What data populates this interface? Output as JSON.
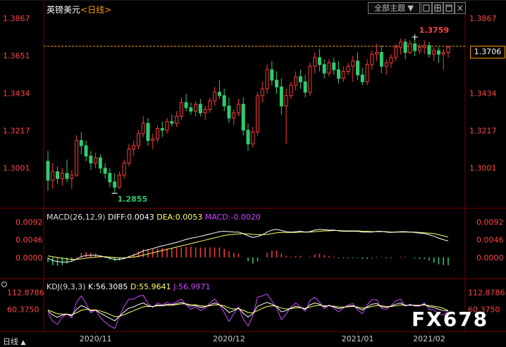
{
  "header": {
    "symbol": "英镑美元",
    "period": "<日线>",
    "theme_button": "全部主题",
    "theme_arrow": "▼"
  },
  "current_price": "1.3706",
  "watermark": "FX678",
  "period_tab": "日线",
  "period_tab_arrow": "▲",
  "macd_label": {
    "name": "MACD(26,12,9)",
    "diff": "DIFF:0.0043",
    "dea": "DEA:0.0053",
    "macd": "MACD:-0.0020"
  },
  "kdj_label": {
    "name": "KDJ(9,3,3)",
    "k": "K:56.3085",
    "d": "D:55.9641",
    "j": "J:56.9971"
  },
  "colors": {
    "up": "#ff3a3a",
    "down": "#2ecc71",
    "axis": "#ff4444",
    "diff_line": "#ffffff",
    "dea_line": "#ffff66",
    "j_line": "#cc44ff"
  },
  "chart_data": {
    "type": "candlestick",
    "y_ticks": [
      "1.3867",
      "1.3651",
      "1.3434",
      "1.3217",
      "1.3001"
    ],
    "ylim": [
      1.2792,
      1.3941
    ],
    "max_label": "1.3759",
    "min_label": "1.2855",
    "reference_level": 1.3706,
    "x_ticks": [
      "2020/11",
      "2020/12",
      "2021/01",
      "2021/02"
    ],
    "candles": [
      {
        "o": 1.304,
        "h": 1.31,
        "l": 1.287,
        "c": 1.293
      },
      {
        "o": 1.293,
        "h": 1.303,
        "l": 1.288,
        "c": 1.298
      },
      {
        "o": 1.298,
        "h": 1.301,
        "l": 1.291,
        "c": 1.294
      },
      {
        "o": 1.294,
        "h": 1.3,
        "l": 1.29,
        "c": 1.297
      },
      {
        "o": 1.297,
        "h": 1.305,
        "l": 1.292,
        "c": 1.294
      },
      {
        "o": 1.294,
        "h": 1.299,
        "l": 1.288,
        "c": 1.296
      },
      {
        "o": 1.296,
        "h": 1.319,
        "l": 1.295,
        "c": 1.316
      },
      {
        "o": 1.316,
        "h": 1.321,
        "l": 1.308,
        "c": 1.313
      },
      {
        "o": 1.313,
        "h": 1.316,
        "l": 1.304,
        "c": 1.307
      },
      {
        "o": 1.307,
        "h": 1.31,
        "l": 1.299,
        "c": 1.303
      },
      {
        "o": 1.303,
        "h": 1.309,
        "l": 1.3,
        "c": 1.306
      },
      {
        "o": 1.306,
        "h": 1.308,
        "l": 1.297,
        "c": 1.3
      },
      {
        "o": 1.3,
        "h": 1.303,
        "l": 1.294,
        "c": 1.297
      },
      {
        "o": 1.297,
        "h": 1.3,
        "l": 1.289,
        "c": 1.292
      },
      {
        "o": 1.292,
        "h": 1.297,
        "l": 1.2855,
        "c": 1.289
      },
      {
        "o": 1.289,
        "h": 1.298,
        "l": 1.288,
        "c": 1.296
      },
      {
        "o": 1.296,
        "h": 1.305,
        "l": 1.294,
        "c": 1.303
      },
      {
        "o": 1.303,
        "h": 1.314,
        "l": 1.301,
        "c": 1.311
      },
      {
        "o": 1.311,
        "h": 1.316,
        "l": 1.307,
        "c": 1.313
      },
      {
        "o": 1.313,
        "h": 1.322,
        "l": 1.311,
        "c": 1.32
      },
      {
        "o": 1.32,
        "h": 1.33,
        "l": 1.318,
        "c": 1.326
      },
      {
        "o": 1.326,
        "h": 1.329,
        "l": 1.313,
        "c": 1.316
      },
      {
        "o": 1.316,
        "h": 1.32,
        "l": 1.311,
        "c": 1.317
      },
      {
        "o": 1.317,
        "h": 1.325,
        "l": 1.315,
        "c": 1.323
      },
      {
        "o": 1.323,
        "h": 1.327,
        "l": 1.318,
        "c": 1.322
      },
      {
        "o": 1.322,
        "h": 1.329,
        "l": 1.32,
        "c": 1.327
      },
      {
        "o": 1.327,
        "h": 1.331,
        "l": 1.324,
        "c": 1.326
      },
      {
        "o": 1.326,
        "h": 1.333,
        "l": 1.324,
        "c": 1.33
      },
      {
        "o": 1.33,
        "h": 1.341,
        "l": 1.328,
        "c": 1.338
      },
      {
        "o": 1.338,
        "h": 1.343,
        "l": 1.333,
        "c": 1.335
      },
      {
        "o": 1.335,
        "h": 1.338,
        "l": 1.331,
        "c": 1.333
      },
      {
        "o": 1.333,
        "h": 1.339,
        "l": 1.33,
        "c": 1.337
      },
      {
        "o": 1.337,
        "h": 1.34,
        "l": 1.33,
        "c": 1.332
      },
      {
        "o": 1.332,
        "h": 1.336,
        "l": 1.328,
        "c": 1.334
      },
      {
        "o": 1.334,
        "h": 1.341,
        "l": 1.332,
        "c": 1.339
      },
      {
        "o": 1.339,
        "h": 1.347,
        "l": 1.336,
        "c": 1.344
      },
      {
        "o": 1.344,
        "h": 1.351,
        "l": 1.34,
        "c": 1.342
      },
      {
        "o": 1.342,
        "h": 1.346,
        "l": 1.333,
        "c": 1.336
      },
      {
        "o": 1.336,
        "h": 1.341,
        "l": 1.326,
        "c": 1.329
      },
      {
        "o": 1.329,
        "h": 1.334,
        "l": 1.325,
        "c": 1.332
      },
      {
        "o": 1.332,
        "h": 1.34,
        "l": 1.33,
        "c": 1.337
      },
      {
        "o": 1.337,
        "h": 1.341,
        "l": 1.319,
        "c": 1.322
      },
      {
        "o": 1.322,
        "h": 1.326,
        "l": 1.31,
        "c": 1.314
      },
      {
        "o": 1.314,
        "h": 1.324,
        "l": 1.312,
        "c": 1.321
      },
      {
        "o": 1.321,
        "h": 1.344,
        "l": 1.319,
        "c": 1.342
      },
      {
        "o": 1.342,
        "h": 1.35,
        "l": 1.338,
        "c": 1.346
      },
      {
        "o": 1.346,
        "h": 1.36,
        "l": 1.343,
        "c": 1.357
      },
      {
        "o": 1.357,
        "h": 1.362,
        "l": 1.348,
        "c": 1.351
      },
      {
        "o": 1.351,
        "h": 1.356,
        "l": 1.343,
        "c": 1.347
      },
      {
        "o": 1.347,
        "h": 1.352,
        "l": 1.331,
        "c": 1.336
      },
      {
        "o": 1.336,
        "h": 1.346,
        "l": 1.314,
        "c": 1.342
      },
      {
        "o": 1.342,
        "h": 1.35,
        "l": 1.34,
        "c": 1.348
      },
      {
        "o": 1.348,
        "h": 1.356,
        "l": 1.345,
        "c": 1.353
      },
      {
        "o": 1.353,
        "h": 1.357,
        "l": 1.346,
        "c": 1.35
      },
      {
        "o": 1.35,
        "h": 1.354,
        "l": 1.341,
        "c": 1.344
      },
      {
        "o": 1.344,
        "h": 1.361,
        "l": 1.342,
        "c": 1.359
      },
      {
        "o": 1.359,
        "h": 1.367,
        "l": 1.355,
        "c": 1.364
      },
      {
        "o": 1.364,
        "h": 1.369,
        "l": 1.356,
        "c": 1.36
      },
      {
        "o": 1.36,
        "h": 1.363,
        "l": 1.352,
        "c": 1.355
      },
      {
        "o": 1.355,
        "h": 1.363,
        "l": 1.353,
        "c": 1.361
      },
      {
        "o": 1.361,
        "h": 1.364,
        "l": 1.354,
        "c": 1.357
      },
      {
        "o": 1.357,
        "h": 1.362,
        "l": 1.349,
        "c": 1.352
      },
      {
        "o": 1.352,
        "h": 1.359,
        "l": 1.35,
        "c": 1.356
      },
      {
        "o": 1.356,
        "h": 1.361,
        "l": 1.354,
        "c": 1.359
      },
      {
        "o": 1.359,
        "h": 1.365,
        "l": 1.35,
        "c": 1.362
      },
      {
        "o": 1.362,
        "h": 1.367,
        "l": 1.351,
        "c": 1.354
      },
      {
        "o": 1.354,
        "h": 1.358,
        "l": 1.348,
        "c": 1.35
      },
      {
        "o": 1.35,
        "h": 1.363,
        "l": 1.348,
        "c": 1.36
      },
      {
        "o": 1.36,
        "h": 1.368,
        "l": 1.357,
        "c": 1.366
      },
      {
        "o": 1.366,
        "h": 1.372,
        "l": 1.362,
        "c": 1.367
      },
      {
        "o": 1.367,
        "h": 1.371,
        "l": 1.355,
        "c": 1.359
      },
      {
        "o": 1.359,
        "h": 1.363,
        "l": 1.354,
        "c": 1.361
      },
      {
        "o": 1.361,
        "h": 1.366,
        "l": 1.358,
        "c": 1.364
      },
      {
        "o": 1.364,
        "h": 1.372,
        "l": 1.362,
        "c": 1.37
      },
      {
        "o": 1.37,
        "h": 1.375,
        "l": 1.366,
        "c": 1.373
      },
      {
        "o": 1.373,
        "h": 1.375,
        "l": 1.363,
        "c": 1.367
      },
      {
        "o": 1.367,
        "h": 1.374,
        "l": 1.366,
        "c": 1.372
      },
      {
        "o": 1.372,
        "h": 1.3759,
        "l": 1.365,
        "c": 1.368
      },
      {
        "o": 1.368,
        "h": 1.372,
        "l": 1.366,
        "c": 1.37
      },
      {
        "o": 1.37,
        "h": 1.374,
        "l": 1.366,
        "c": 1.371
      },
      {
        "o": 1.371,
        "h": 1.373,
        "l": 1.364,
        "c": 1.366
      },
      {
        "o": 1.366,
        "h": 1.37,
        "l": 1.362,
        "c": 1.368
      },
      {
        "o": 1.368,
        "h": 1.37,
        "l": 1.361,
        "c": 1.366
      },
      {
        "o": 1.366,
        "h": 1.369,
        "l": 1.357,
        "c": 1.367
      },
      {
        "o": 1.367,
        "h": 1.371,
        "l": 1.364,
        "c": 1.37
      }
    ],
    "macd": {
      "y_ticks": [
        "0.0092",
        "0.0046",
        "0.0000"
      ],
      "ylim": [
        -0.0048,
        0.0102
      ],
      "diff": [
        -0.0002,
        -0.0008,
        -0.0011,
        -0.0012,
        -0.0012,
        -0.001,
        -0.0004,
        0.0002,
        0.0005,
        0.0006,
        0.0006,
        0.0004,
        0.0001,
        -0.0002,
        -0.0005,
        -0.0005,
        -0.0003,
        0.0002,
        0.0006,
        0.0011,
        0.0017,
        0.002,
        0.0023,
        0.0027,
        0.003,
        0.0033,
        0.0036,
        0.0039,
        0.0043,
        0.0047,
        0.005,
        0.0052,
        0.0055,
        0.0058,
        0.0061,
        0.0064,
        0.0067,
        0.0068,
        0.0067,
        0.0066,
        0.0066,
        0.0062,
        0.0056,
        0.0052,
        0.0054,
        0.0059,
        0.0066,
        0.0071,
        0.0073,
        0.007,
        0.0067,
        0.0066,
        0.0067,
        0.0068,
        0.0066,
        0.0067,
        0.0071,
        0.0073,
        0.0072,
        0.0071,
        0.0071,
        0.0069,
        0.0068,
        0.0068,
        0.0068,
        0.0068,
        0.0066,
        0.0066,
        0.0066,
        0.0068,
        0.0068,
        0.0066,
        0.0065,
        0.0066,
        0.0067,
        0.0067,
        0.0066,
        0.0065,
        0.0063,
        0.0062,
        0.0059,
        0.0055,
        0.005,
        0.0046,
        0.0043
      ],
      "dea": [
        0.0004,
        0.0002,
        0.0,
        -0.0002,
        -0.0004,
        -0.0005,
        -0.0005,
        -0.0004,
        -0.0002,
        0.0,
        0.0001,
        0.0002,
        0.0002,
        0.0001,
        0.0,
        -0.0001,
        -0.0001,
        0.0,
        0.0001,
        0.0003,
        0.0006,
        0.0009,
        0.0012,
        0.0015,
        0.0018,
        0.0021,
        0.0024,
        0.0027,
        0.003,
        0.0033,
        0.0036,
        0.0039,
        0.0042,
        0.0045,
        0.0048,
        0.0051,
        0.0054,
        0.0057,
        0.0059,
        0.006,
        0.0061,
        0.0062,
        0.0061,
        0.006,
        0.0059,
        0.0059,
        0.006,
        0.0062,
        0.0064,
        0.0065,
        0.0065,
        0.0065,
        0.0065,
        0.0066,
        0.0066,
        0.0066,
        0.0067,
        0.0068,
        0.0069,
        0.0069,
        0.007,
        0.007,
        0.0069,
        0.0069,
        0.0069,
        0.0069,
        0.0068,
        0.0068,
        0.0067,
        0.0067,
        0.0067,
        0.0067,
        0.0066,
        0.0066,
        0.0066,
        0.0066,
        0.0066,
        0.0066,
        0.0065,
        0.0064,
        0.0063,
        0.0062,
        0.0059,
        0.0056,
        0.0053
      ]
    },
    "kdj": {
      "y_ticks": [
        "112.8786",
        "60.3750"
      ],
      "ylim": [
        -5,
        125
      ],
      "k": [
        55,
        42,
        35,
        42,
        45,
        40,
        60,
        72,
        66,
        55,
        58,
        48,
        40,
        32,
        24,
        38,
        52,
        64,
        68,
        75,
        80,
        72,
        68,
        74,
        72,
        76,
        74,
        78,
        82,
        76,
        70,
        72,
        66,
        68,
        74,
        80,
        74,
        64,
        50,
        56,
        64,
        48,
        36,
        46,
        70,
        76,
        82,
        76,
        68,
        52,
        56,
        64,
        70,
        66,
        60,
        74,
        80,
        76,
        68,
        72,
        68,
        62,
        66,
        70,
        72,
        64,
        58,
        68,
        76,
        78,
        68,
        66,
        70,
        76,
        80,
        72,
        74,
        72,
        72,
        76,
        68,
        66,
        60,
        56,
        56
      ],
      "d": [
        58,
        52,
        46,
        45,
        45,
        43,
        49,
        57,
        60,
        58,
        58,
        55,
        50,
        44,
        37,
        38,
        43,
        50,
        56,
        62,
        68,
        69,
        69,
        71,
        71,
        73,
        73,
        75,
        77,
        77,
        75,
        74,
        71,
        70,
        71,
        74,
        74,
        71,
        64,
        61,
        62,
        57,
        50,
        49,
        56,
        63,
        69,
        71,
        70,
        64,
        61,
        62,
        65,
        65,
        63,
        67,
        71,
        73,
        71,
        71,
        70,
        67,
        67,
        68,
        69,
        67,
        64,
        65,
        69,
        72,
        71,
        69,
        69,
        71,
        74,
        73,
        73,
        73,
        73,
        74,
        72,
        70,
        67,
        63,
        56
      ],
      "j": [
        50,
        22,
        13,
        36,
        45,
        34,
        82,
        102,
        78,
        49,
        58,
        34,
        20,
        8,
        0,
        38,
        70,
        92,
        92,
        101,
        104,
        78,
        66,
        80,
        74,
        82,
        76,
        84,
        92,
        74,
        60,
        68,
        56,
        64,
        80,
        92,
        74,
        50,
        22,
        46,
        68,
        30,
        8,
        40,
        98,
        102,
        108,
        86,
        64,
        28,
        46,
        68,
        80,
        68,
        54,
        88,
        98,
        82,
        62,
        74,
        64,
        52,
        64,
        74,
        78,
        58,
        46,
        74,
        90,
        90,
        62,
        60,
        72,
        86,
        92,
        70,
        76,
        70,
        70,
        80,
        60,
        58,
        46,
        42,
        57
      ]
    }
  }
}
